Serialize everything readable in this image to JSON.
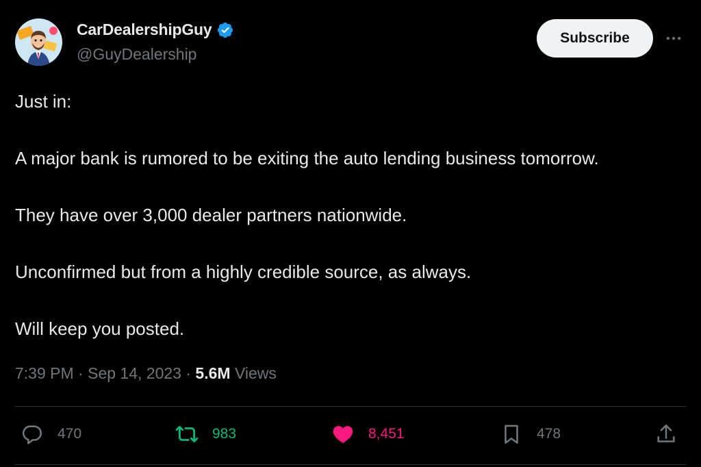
{
  "author": {
    "display_name": "CarDealershipGuy",
    "handle": "@GuyDealership",
    "verified": true,
    "verified_color": "#1d9bf0"
  },
  "header": {
    "subscribe_label": "Subscribe",
    "more_icon": "more-horizontal-icon"
  },
  "tweet": {
    "paragraphs": [
      "Just in:",
      "A major bank is rumored to be exiting the auto lending business tomorrow.",
      "They have over 3,000 dealer partners nationwide.",
      "Unconfirmed but from a highly credible source, as always.",
      "Will keep you posted."
    ]
  },
  "meta": {
    "time": "7:39 PM",
    "separator": "·",
    "date": "Sep 14, 2023",
    "views_count": "5.6M",
    "views_label": "Views"
  },
  "actions": {
    "reply_count": "470",
    "retweet_count": "983",
    "like_count": "8,451",
    "bookmark_count": "478",
    "retweet_color": "#00ba7c",
    "like_color": "#f91880"
  }
}
